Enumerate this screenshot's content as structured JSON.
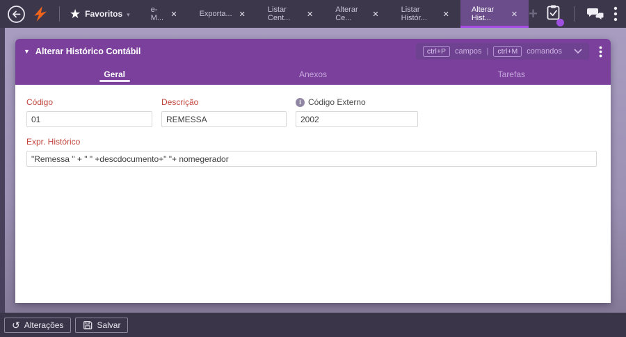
{
  "topbar": {
    "favorites_label": "Favoritos",
    "tabs": [
      {
        "label": "e-M..."
      },
      {
        "label": "Exporta..."
      },
      {
        "label": "Listar Cent..."
      },
      {
        "label": "Alterar Ce..."
      },
      {
        "label": "Listar Histór..."
      },
      {
        "label": "Alterar Hist...",
        "active": true
      }
    ]
  },
  "panel": {
    "title": "Alterar Histórico Contábil",
    "shortcuts": {
      "fields_key": "ctrl+P",
      "fields_label": "campos",
      "separator": "|",
      "commands_key": "ctrl+M",
      "commands_label": "comandos"
    },
    "tabs": [
      {
        "label": "Geral",
        "active": true
      },
      {
        "label": "Anexos"
      },
      {
        "label": "Tarefas"
      }
    ],
    "form": {
      "codigo": {
        "label": "Código",
        "value": "01"
      },
      "descricao": {
        "label": "Descrição",
        "value": "REMESSA"
      },
      "codigo_externo": {
        "label": "Código Externo",
        "value": "2002"
      },
      "expr_historico": {
        "label": "Expr. Histórico",
        "value": "\"Remessa \" + \" \" +descdocumento+\" \"+ nomegerador"
      }
    }
  },
  "footer": {
    "alteracoes_label": "Alterações",
    "salvar_label": "Salvar"
  },
  "icons": {
    "star": "★",
    "favorites_chevron": "▾",
    "close": "✕",
    "plus": "+",
    "title_caret": "▼",
    "info": "i",
    "history": "↺"
  },
  "colors": {
    "brand_orange": "#f2641c",
    "panel_purple": "#7b3f9c",
    "active_tab_underline": "#a44ce4",
    "label_red": "#c2453c",
    "notification_dot": "#a050e0",
    "topbar_bg": "#3d374c"
  }
}
